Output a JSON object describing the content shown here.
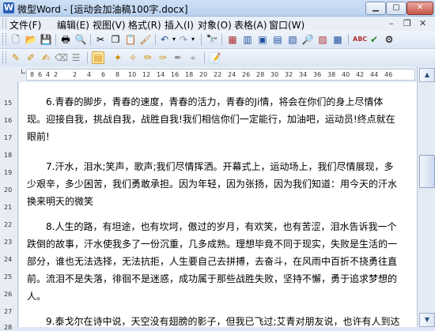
{
  "window": {
    "title": "微型Word - [运动会加油稿100字.docx]",
    "controls": [
      "minimize",
      "maximize",
      "close"
    ]
  },
  "menubar": {
    "items": [
      "文件(F)",
      "编辑(E)",
      "视图(V)",
      "格式(R)",
      "插入(I)",
      "对象(O)",
      "表格(A)",
      "窗口(W)"
    ]
  },
  "toolbar1": {
    "icons": [
      "new-document-icon",
      "open-folder-icon",
      "save-icon",
      "print-icon",
      "print-preview-icon",
      "cut-icon",
      "copy-icon",
      "paste-icon",
      "format-painter-icon",
      "undo-icon",
      "redo-icon",
      "find-icon",
      "table-icon",
      "columns-icon",
      "image-icon",
      "zoom-icon",
      "insert-object-icon",
      "chart-icon",
      "spellcheck-icon",
      "check-icon",
      "tools-icon"
    ]
  },
  "toolbar2": {
    "icons": [
      "new-style-icon",
      "edit-style-icon",
      "insert-field-icon",
      "delete-field-icon",
      "properties-icon",
      "paste-format-icon",
      "highlight-icon",
      "marker-icon",
      "pencil-icon",
      "eraser-icon",
      "brush-icon",
      "edit-doc-icon"
    ]
  },
  "ruler": {
    "numbers": [
      "8",
      "6",
      "4",
      "2",
      "2",
      "4",
      "6",
      "8",
      "10",
      "12",
      "14",
      "16",
      "18",
      "20",
      "22",
      "24",
      "26",
      "28",
      "30",
      "32",
      "34",
      "36",
      "38",
      "40",
      "42",
      "44",
      "46"
    ]
  },
  "vruler": {
    "numbers": [
      "15",
      "16",
      "17",
      "18",
      "19",
      "20",
      "21",
      "22",
      "23",
      "24",
      "25",
      "26",
      "27",
      "28"
    ]
  },
  "document": {
    "paragraphs": [
      "6.青春的脚步，青春的速度，青春的活力，青春的Ji情，将会在你们的身上尽情体现。迎接自我，挑战自我，战胜自我!我们相信你们一定能行，加油吧，运动员!终点就在眼前!",
      "7.汗水，泪水;笑声，歌声;我们尽情挥洒。开幕式上，运动场上，我们尽情展现，多少艰辛，多少困苦，我们勇敢承担。因为年轻，因为张扬，因为我们知道：用今天的汗水换来明天的微笑",
      "8.人生的路，有坦途，也有坎坷，傲过的岁月，有欢笑，也有苦涩，泪水告诉我一个跌倒的故事，汗水使我多了一份沉重，几多成熟。理想毕竟不同于现实，失败是生活的一部分，谁也无法选择，无法抗拒，人生要自己去拼搏，去奋斗，在风雨中百折不挠勇往直前。流泪不是失落，徘徊不是迷惑，成功属于那些战胜失败，坚持不懈，勇于追求梦想的人。",
      "9.泰戈尔在诗中说，天空没有翅膀的影子，但我已飞过;艾青对朋友说，也许有人到达"
    ]
  }
}
